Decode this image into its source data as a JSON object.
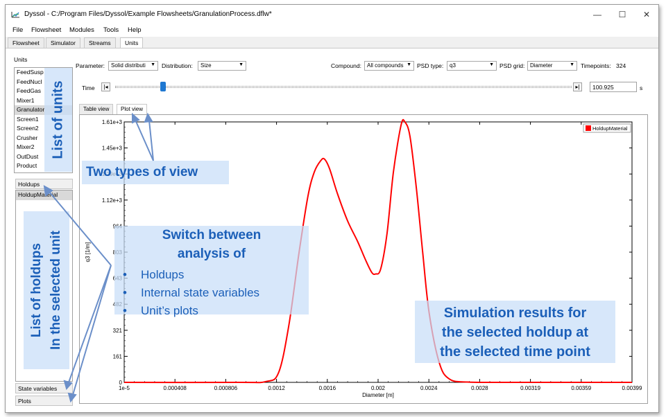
{
  "window": {
    "title": "Dyssol - C:/Program Files/Dyssol/Example Flowsheets/GranulationProcess.dflw*",
    "controls": {
      "minimize": "—",
      "maximize": "☐",
      "close": "✕"
    }
  },
  "menu": [
    "File",
    "Flowsheet",
    "Modules",
    "Tools",
    "Help"
  ],
  "tabs": [
    "Flowsheet",
    "Simulator",
    "Streams",
    "Units"
  ],
  "units_panel": {
    "label": "Units",
    "items": [
      "FeedSusp",
      "FeedNucl",
      "FeedGas",
      "Mixer1",
      "Granulator",
      "Screen1",
      "Screen2",
      "Crusher",
      "Mixer2",
      "OutDust",
      "Product"
    ],
    "selected_index": 4
  },
  "holdups_panel": {
    "label": "Holdups",
    "items": [
      "HoldupMaterial"
    ]
  },
  "state_variables_label": "State variables",
  "plots_label": "Plots",
  "controls": {
    "parameter_label": "Parameter:",
    "parameter_value": "Solid distributi",
    "distribution_label": "Distribution:",
    "distribution_value": "Size",
    "compound_label": "Compound:",
    "compound_value": "All compounds",
    "psd_type_label": "PSD type:",
    "psd_type_value": "q3",
    "psd_grid_label": "PSD grid:",
    "psd_grid_value": "Diameter",
    "timepoints_label": "Timepoints:",
    "timepoints_value": "324",
    "time_label": "Time",
    "time_value": "100.925",
    "time_unit": "s",
    "time_slider_fraction": 0.1
  },
  "view_tabs": [
    "Table view",
    "Plot view"
  ],
  "chart_data": {
    "type": "line",
    "xlabel": "Diameter [m]",
    "ylabel": "q3 [1/m]",
    "x_ticks": [
      "1e-5",
      "0.000408",
      "0.000806",
      "0.0012",
      "0.0016",
      "0.002",
      "0.0024",
      "0.0028",
      "0.00319",
      "0.00359",
      "0.00399"
    ],
    "y_ticks": [
      "0",
      "161",
      "321",
      "482",
      "643",
      "803",
      "964",
      "1.12e+3",
      "1.29e+3",
      "1.45e+3",
      "1.61e+3"
    ],
    "xlim": [
      1e-05,
      0.00399
    ],
    "ylim": [
      0,
      1610
    ],
    "legend": "top-right",
    "series": [
      {
        "name": "HoldupMaterial",
        "color": "#ff0000",
        "x": [
          1e-05,
          0.0009,
          0.00112,
          0.00122,
          0.0013,
          0.00138,
          0.00145,
          0.0015,
          0.00155,
          0.00158,
          0.00162,
          0.00168,
          0.00176,
          0.00184,
          0.0019,
          0.00195,
          0.00198,
          0.00202,
          0.00207,
          0.00212,
          0.00218,
          0.00221,
          0.00225,
          0.0023,
          0.00235,
          0.0024,
          0.00248,
          0.00256,
          0.0027,
          0.003,
          0.00399
        ],
        "y": [
          0,
          0,
          5,
          60,
          350,
          800,
          1150,
          1300,
          1370,
          1380,
          1320,
          1170,
          1000,
          870,
          760,
          680,
          670,
          700,
          920,
          1300,
          1590,
          1610,
          1520,
          1200,
          800,
          430,
          120,
          20,
          2,
          0,
          0
        ]
      }
    ]
  },
  "annotations": {
    "list_of_units": "List of units",
    "two_types_of_view": "Two types of view",
    "switch_title_1": "Switch between",
    "switch_title_2": "analysis of",
    "switch_items": [
      "Holdups",
      "Internal state variables",
      "Unit’s plots"
    ],
    "list_of_holdups_1": "List of holdups",
    "list_of_holdups_2": "In the selected unit",
    "results_1": "Simulation results for",
    "results_2": "the selected holdup at",
    "results_3": "the selected time point",
    "accent_color": "#1b5fb8"
  }
}
